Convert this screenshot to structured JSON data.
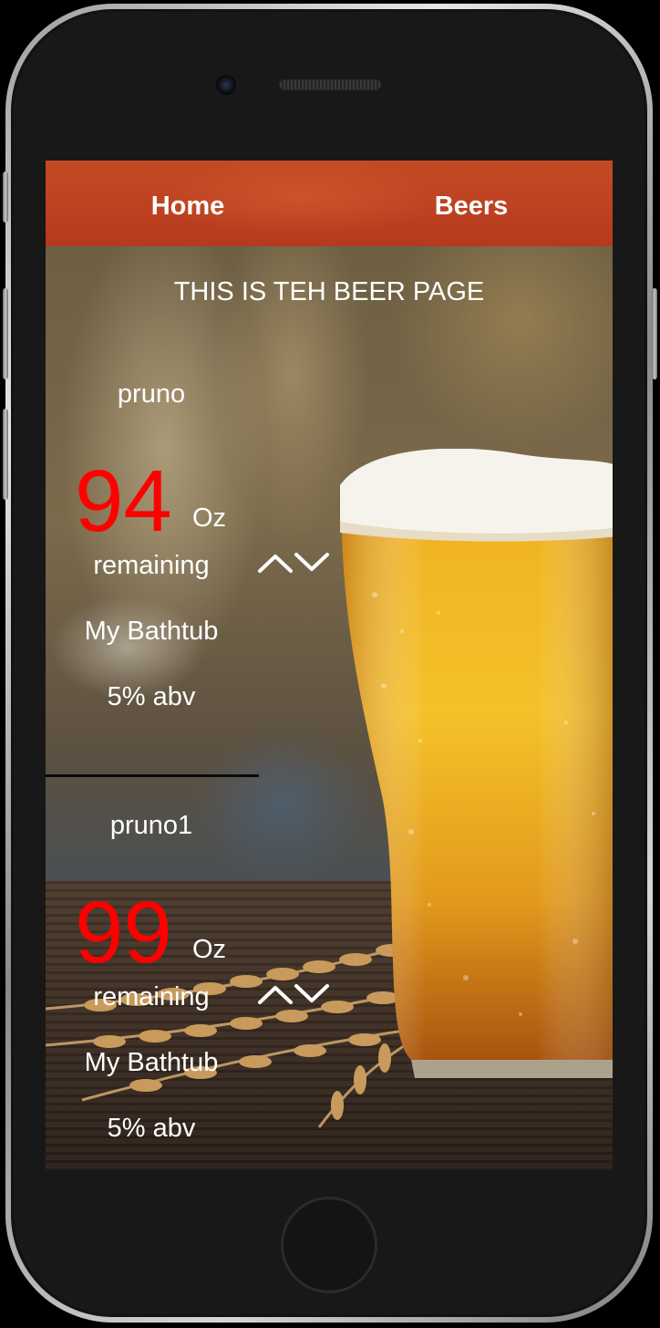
{
  "nav": {
    "home_label": "Home",
    "beers_label": "Beers"
  },
  "page": {
    "title": "THIS IS TEH BEER PAGE"
  },
  "beers": [
    {
      "name": "pruno",
      "ounces": "94",
      "unit": "Oz",
      "remaining_label": "remaining",
      "location": "My Bathtub",
      "abv": "5% abv"
    },
    {
      "name": "pruno1",
      "ounces": "99",
      "unit": "Oz",
      "remaining_label": "remaining",
      "location": "My Bathtub",
      "abv": "5% abv"
    }
  ],
  "icons": {
    "increment": "chevron-up-icon",
    "decrement": "chevron-down-icon"
  },
  "colors": {
    "nav_bar": "#bd4121",
    "ounces_text": "#ff0000",
    "text": "#ffffff"
  }
}
